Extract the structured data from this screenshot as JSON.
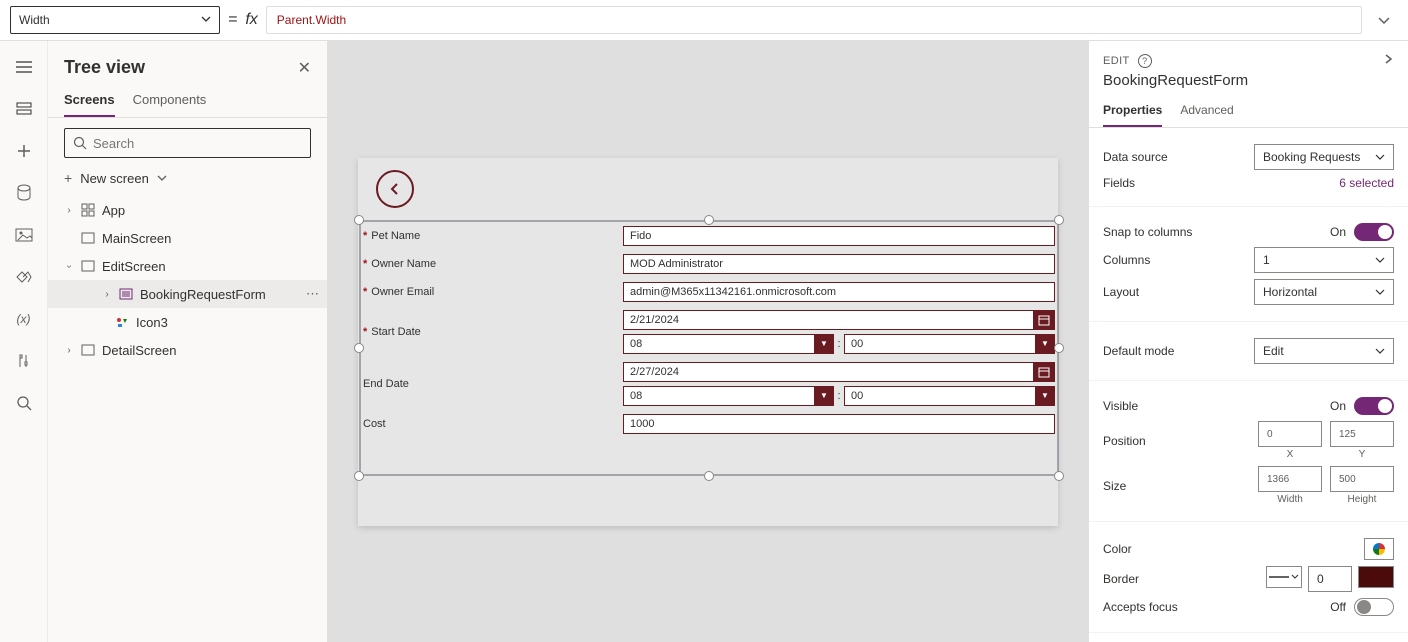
{
  "formula_bar": {
    "property": "Width",
    "token1": "Parent",
    "dot": ".",
    "token2": "Width"
  },
  "tree": {
    "title": "Tree view",
    "tabs": {
      "screens": "Screens",
      "components": "Components"
    },
    "search_placeholder": "Search",
    "new_screen": "New screen",
    "items": {
      "app": "App",
      "mainscreen": "MainScreen",
      "editscreen": "EditScreen",
      "bookingform": "BookingRequestForm",
      "icon3": "Icon3",
      "detailscreen": "DetailScreen"
    }
  },
  "form": {
    "labels": {
      "pet": "Pet Name",
      "owner": "Owner Name",
      "email": "Owner Email",
      "start": "Start Date",
      "end": "End Date",
      "cost": "Cost"
    },
    "values": {
      "pet": "Fido",
      "owner": "MOD Administrator",
      "email": "admin@M365x11342161.onmicrosoft.com",
      "start_date": "2/21/2024",
      "start_hour": "08",
      "start_min": "00",
      "end_date": "2/27/2024",
      "end_hour": "08",
      "end_min": "00",
      "cost": "1000"
    }
  },
  "right": {
    "edit": "EDIT",
    "name": "BookingRequestForm",
    "tabs": {
      "properties": "Properties",
      "advanced": "Advanced"
    },
    "labels": {
      "data_source": "Data source",
      "fields": "Fields",
      "snap": "Snap to columns",
      "columns": "Columns",
      "layout": "Layout",
      "default_mode": "Default mode",
      "visible": "Visible",
      "position": "Position",
      "size": "Size",
      "width_lbl": "Width",
      "height_lbl": "Height",
      "x": "X",
      "y": "Y",
      "color": "Color",
      "border": "Border",
      "accepts_focus": "Accepts focus"
    },
    "values": {
      "data_source": "Booking Requests",
      "fields_link": "6 selected",
      "snap": "On",
      "columns": "1",
      "layout": "Horizontal",
      "default_mode": "Edit",
      "visible": "On",
      "x": "0",
      "y": "125",
      "width": "1366",
      "height": "500",
      "border_width": "0",
      "accepts_focus": "Off"
    }
  }
}
